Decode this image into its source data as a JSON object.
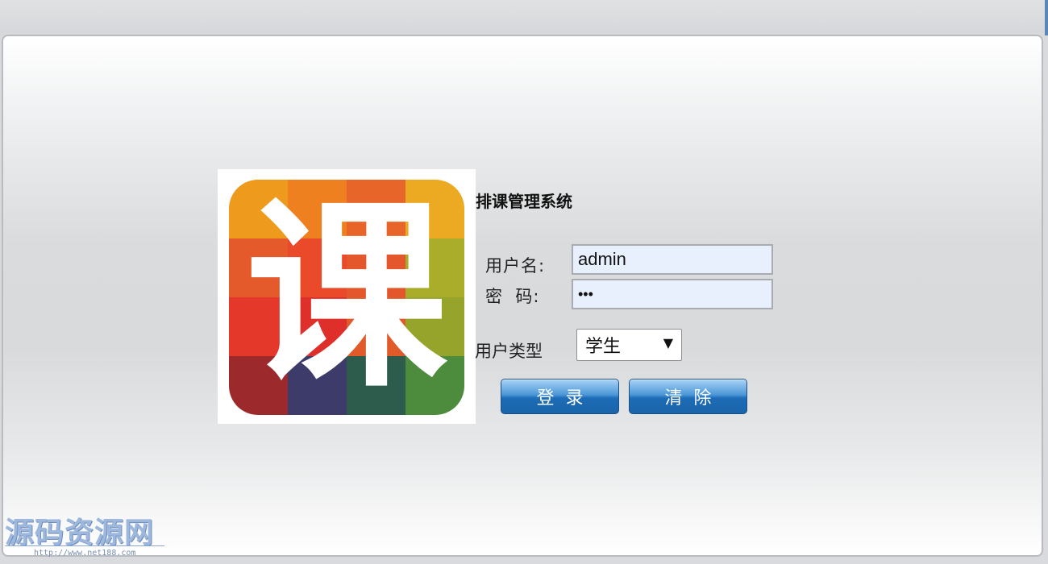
{
  "app": {
    "title": "排课管理系统"
  },
  "logo": {
    "character": "课",
    "tile_colors": [
      "#ee9a1d",
      "#ef8020",
      "#e8652a",
      "#ebaa22",
      "#e45a2a",
      "#ea4a2a",
      "#e4562c",
      "#a9ad2a",
      "#e3382a",
      "#df2f2b",
      "#e05a2a",
      "#96a42c",
      "#9c2a2c",
      "#3c3b6a",
      "#2d5b4c",
      "#4d8c3c"
    ]
  },
  "form": {
    "username_label": "用户名:",
    "username_value": "admin",
    "password_label": "密  码:",
    "password_value": "•••",
    "usertype_label": "用户类型",
    "usertype_selected": "学生",
    "login_button": "登录",
    "clear_button": "清除"
  },
  "watermark": {
    "text": "源码资源网",
    "url": "http://www.net188.com"
  },
  "colors": {
    "button_blue": "#1d6cb6",
    "input_bg": "#e9f0fd"
  }
}
